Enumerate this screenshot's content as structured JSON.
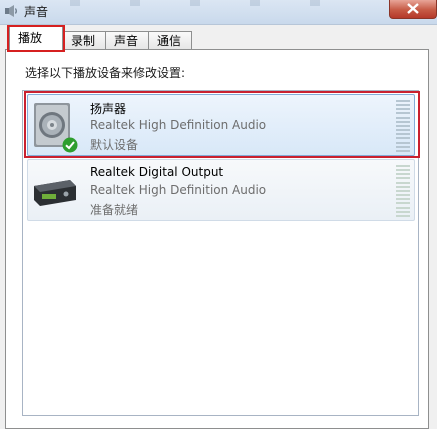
{
  "window": {
    "title": "声音",
    "title_icon": "speaker-icon"
  },
  "tabs": [
    {
      "label": "播放",
      "active": true
    },
    {
      "label": "录制",
      "active": false
    },
    {
      "label": "声音",
      "active": false
    },
    {
      "label": "通信",
      "active": false
    }
  ],
  "instruction": "选择以下播放设备来修改设置:",
  "devices": [
    {
      "name": "扬声器",
      "description": "Realtek High Definition Audio",
      "status": "默认设备",
      "icon": "speaker-icon",
      "badge": "green-check-icon",
      "selected": true
    },
    {
      "name": "Realtek Digital Output",
      "description": "Realtek High Definition Audio",
      "status": "准备就绪",
      "icon": "digital-output-icon",
      "selected": false
    }
  ],
  "colors": {
    "selection_border": "#c9202f",
    "selection_fill": "#d8e8f8",
    "check_green": "#2e9e2e"
  }
}
